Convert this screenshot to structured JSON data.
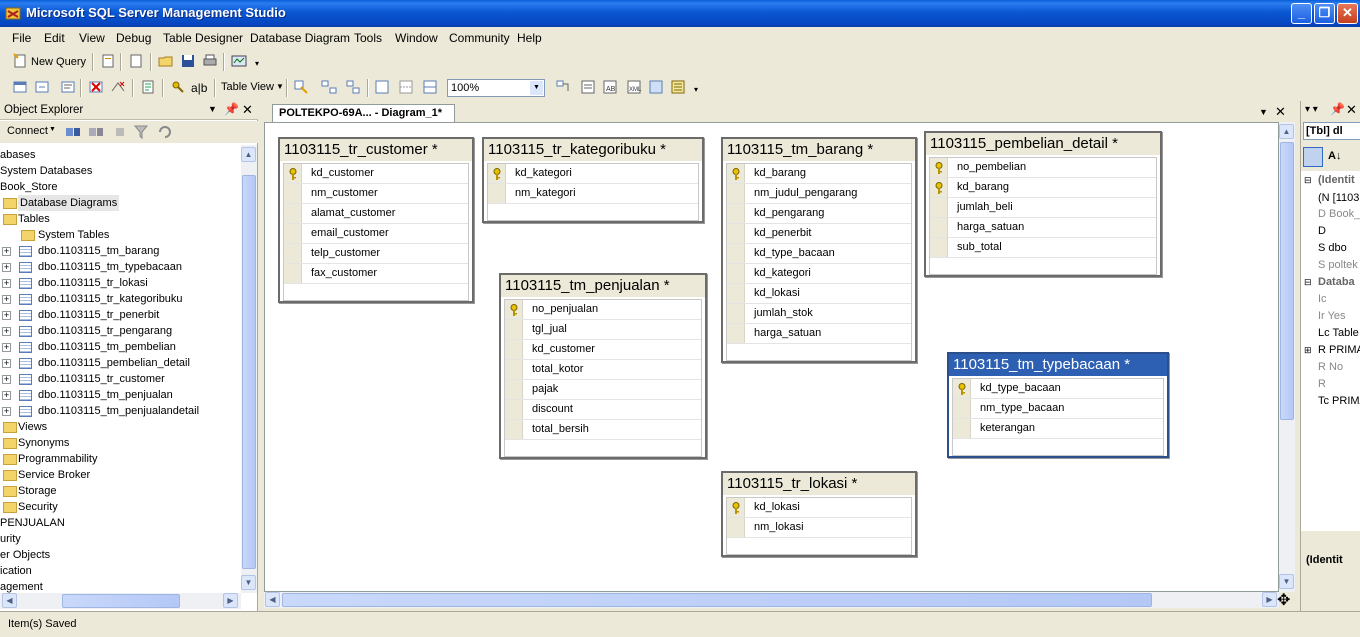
{
  "app": {
    "title": "Microsoft SQL Server Management Studio"
  },
  "menu": [
    "File",
    "Edit",
    "View",
    "Debug",
    "Table Designer",
    "Database Diagram",
    "Tools",
    "Window",
    "Community",
    "Help"
  ],
  "toolbar": {
    "new_query": "New Query",
    "table_view": "Table View",
    "zoom": "100%"
  },
  "object_explorer": {
    "title": "Object Explorer",
    "connect": "Connect",
    "nodes": [
      "abases",
      "System Databases",
      "Book_Store",
      "Database Diagrams",
      "Tables",
      "System Tables",
      "dbo.1103115_tm_barang",
      "dbo.1103115_tm_typebacaan",
      "dbo.1103115_tr_lokasi",
      "dbo.1103115_tr_kategoribuku",
      "dbo.1103115_tr_penerbit",
      "dbo.1103115_tr_pengarang",
      "dbo.1103115_tm_pembelian",
      "dbo.1103115_pembelian_detail",
      "dbo.1103115_tr_customer",
      "dbo.1103115_tm_penjualan",
      "dbo.1103115_tm_penjualandetail",
      "Views",
      "Synonyms",
      "Programmability",
      "Service Broker",
      "Storage",
      "Security",
      "PENJUALAN",
      "urity",
      "er Objects",
      "ication",
      "agement"
    ]
  },
  "document": {
    "tab": "POLTEKPO-69A... - Diagram_1*"
  },
  "diagram": {
    "tables": [
      {
        "name": "1103115_tr_customer *",
        "columns": [
          "kd_customer",
          "nm_customer",
          "alamat_customer",
          "email_customer",
          "telp_customer",
          "fax_customer"
        ],
        "keys": [
          0
        ]
      },
      {
        "name": "1103115_tr_kategoribuku *",
        "columns": [
          "kd_kategori",
          "nm_kategori"
        ],
        "keys": [
          0
        ]
      },
      {
        "name": "1103115_tm_barang *",
        "columns": [
          "kd_barang",
          "nm_judul_pengarang",
          "kd_pengarang",
          "kd_penerbit",
          "kd_type_bacaan",
          "kd_kategori",
          "kd_lokasi",
          "jumlah_stok",
          "harga_satuan"
        ],
        "keys": [
          0
        ]
      },
      {
        "name": "1103115_pembelian_detail *",
        "columns": [
          "no_pembelian",
          "kd_barang",
          "jumlah_beli",
          "harga_satuan",
          "sub_total"
        ],
        "keys": [
          0,
          1
        ]
      },
      {
        "name": "1103115_tm_penjualan *",
        "columns": [
          "no_penjualan",
          "tgl_jual",
          "kd_customer",
          "total_kotor",
          "pajak",
          "discount",
          "total_bersih"
        ],
        "keys": [
          0
        ]
      },
      {
        "name": "1103115_tm_typebacaan *",
        "columns": [
          "kd_type_bacaan",
          "nm_type_bacaan",
          "keterangan"
        ],
        "keys": [
          0
        ]
      },
      {
        "name": "1103115_tr_lokasi *",
        "columns": [
          "kd_lokasi",
          "nm_lokasi"
        ],
        "keys": [
          0
        ]
      }
    ]
  },
  "properties": {
    "dropdown": "[Tbl] dl",
    "items": [
      "(Identit",
      "(N [1103",
      "D Book_",
      "D",
      "S dbo",
      "S poltek",
      "Databa",
      "Ic",
      "Ir Yes",
      "Lc Table",
      "R PRIMA",
      "R No",
      "R",
      "Tc PRIMA"
    ],
    "footer": "(Identit"
  },
  "status": {
    "text": "Item(s) Saved"
  }
}
